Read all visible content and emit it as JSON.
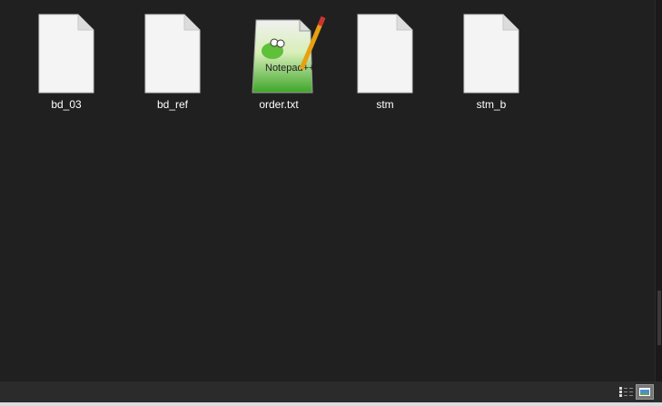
{
  "files": [
    {
      "name": "bd_03",
      "icon": "blank-file-icon"
    },
    {
      "name": "bd_ref",
      "icon": "blank-file-icon"
    },
    {
      "name": "order.txt",
      "icon": "notepad-plus-plus-file-icon"
    },
    {
      "name": "stm",
      "icon": "blank-file-icon"
    },
    {
      "name": "stm_b",
      "icon": "blank-file-icon"
    }
  ],
  "status_bar": {
    "views": [
      "details-view",
      "large-icons-view"
    ],
    "active_view": "large-icons-view"
  }
}
